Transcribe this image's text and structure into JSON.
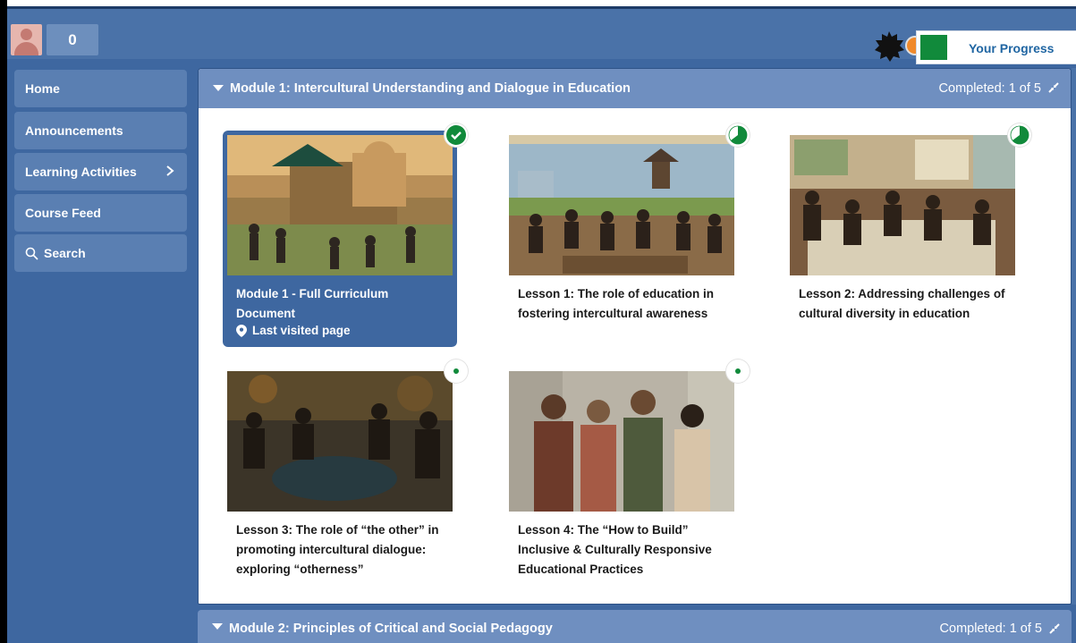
{
  "topbar": {
    "points": "0",
    "progress_label": "Your Progress"
  },
  "sidebar": {
    "items": [
      {
        "label": "Home"
      },
      {
        "label": "Announcements"
      },
      {
        "label": "Learning Activities"
      },
      {
        "label": "Course Feed"
      },
      {
        "label": "Search"
      }
    ]
  },
  "modules": [
    {
      "title": "Module 1: Intercultural Understanding and Dialogue in Education",
      "completed": "Completed: 1 of 5",
      "cards": [
        {
          "label": "Module 1 - Full Curriculum Document",
          "status": "completed",
          "visited_label": "Last visited page"
        },
        {
          "label": "Lesson 1: The role of education in fostering intercultural awareness",
          "status": "in-progress"
        },
        {
          "label": "Lesson 2: Addressing challenges of cultural diversity in education",
          "status": "in-progress"
        },
        {
          "label": "Lesson 3: The role of “the other” in promoting intercultural dialogue: exploring “otherness”",
          "status": "not-started"
        },
        {
          "label": "Lesson 4: The “How to Build” Inclusive & Culturally Responsive Educational Practices",
          "status": "not-started"
        }
      ]
    },
    {
      "title": "Module 2: Principles of Critical and Social Pedagogy",
      "completed": "Completed: 1 of 5"
    }
  ],
  "colors": {
    "accent_green": "#118a3b",
    "nav_blue": "#5a7fb2",
    "header_blue": "#6f8fc0"
  }
}
